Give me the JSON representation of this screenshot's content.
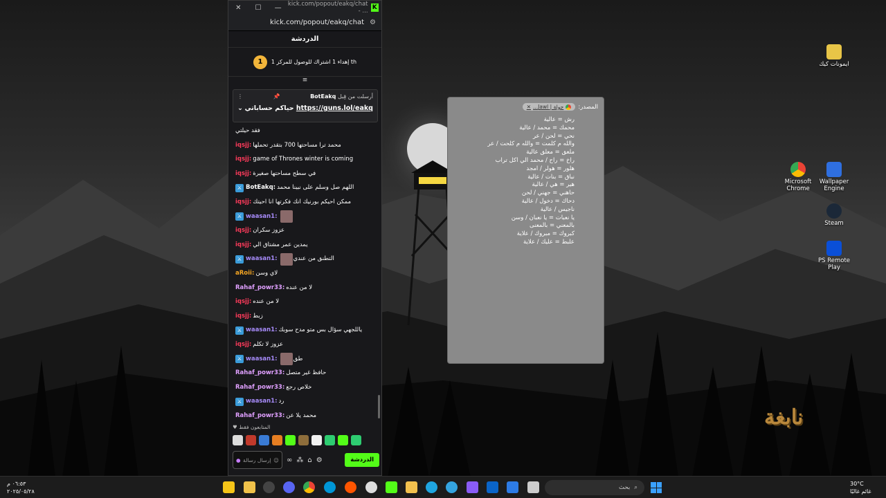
{
  "window": {
    "title": "kick.com/popout/eakq/chat - ...",
    "address": "kick.com/popout/eakq/chat",
    "chat_header": "الدردشة",
    "goal_text": "إهداء 1 اشتراك للوصول للمركز 1 th",
    "goal_badge": "1"
  },
  "pinned": {
    "bot": "BotEakq",
    "sent_label": "أرسلت من قِبل",
    "link": "https://guns.lol/eakq",
    "link_text": "حياكم حساباتي"
  },
  "messages": [
    {
      "user": "",
      "text": "فقد حيلتي",
      "color": "#ffffff",
      "mod": false
    },
    {
      "user": "iqsjj:",
      "text": "محمد ترا مساحتها 700 بتقدر تحملها",
      "color": "#ff3b5b",
      "mod": false
    },
    {
      "user": "iqsjj:",
      "text": "game of Thrones winter is coming",
      "color": "#ff3b5b",
      "mod": false
    },
    {
      "user": "iqsjj:",
      "text": "في سطح مساحتها صغيرة",
      "color": "#ff3b5b",
      "mod": false
    },
    {
      "user": "BotEakq:",
      "text": "اللهم صل وسلم على نبينا محمد",
      "color": "#ffffff",
      "mod": true
    },
    {
      "user": "iqsjj:",
      "text": "ممكن احيكم بورنيك انك فكرتها انا احيتك",
      "color": "#ff3b5b",
      "mod": false
    },
    {
      "user": "waasan1:",
      "text": "",
      "color": "#a78bfa",
      "mod": true,
      "emote": true
    },
    {
      "user": "iqsjj:",
      "text": "عزوز سكران",
      "color": "#ff3b5b",
      "mod": false
    },
    {
      "user": "iqsjj:",
      "text": "يمدين عمر مشتاق الي",
      "color": "#ff3b5b",
      "mod": false
    },
    {
      "user": "waasan1:",
      "text": "التطنق من عندي",
      "color": "#a78bfa",
      "mod": true,
      "emote": true
    },
    {
      "user": "aRoii:",
      "text": "لاي وسن",
      "color": "#f5a623",
      "mod": false
    },
    {
      "user": "Rahaf_powr33:",
      "text": "لا من عنده",
      "color": "#e0a0ff",
      "mod": false
    },
    {
      "user": "iqsjj:",
      "text": "لا من عنده",
      "color": "#ff3b5b",
      "mod": false
    },
    {
      "user": "iqsjj:",
      "text": "زبط",
      "color": "#ff3b5b",
      "mod": false
    },
    {
      "user": "waasan1:",
      "text": "ياللجهي سؤال بس متو مدح سوبك",
      "color": "#a78bfa",
      "mod": true
    },
    {
      "user": "iqsjj:",
      "text": "عزوز لا تكلم",
      "color": "#ff3b5b",
      "mod": false
    },
    {
      "user": "waasan1:",
      "text": "طق",
      "color": "#a78bfa",
      "mod": true,
      "emote": true
    },
    {
      "user": "Rahaf_powr33:",
      "text": "حافظ غير متصل",
      "color": "#e0a0ff",
      "mod": false
    },
    {
      "user": "Rahaf_powr33:",
      "text": "خلاص رجع",
      "color": "#e0a0ff",
      "mod": false
    },
    {
      "user": "waasan1:",
      "text": "رد",
      "color": "#a78bfa",
      "mod": true
    },
    {
      "user": "Rahaf_powr33:",
      "text": "محمد يلا عن",
      "color": "#e0a0ff",
      "mod": false
    }
  ],
  "footer": {
    "subs_label": "المتابعون فقط",
    "input_placeholder": "إرسال رسالة",
    "send_button": "الدردشة"
  },
  "note": {
    "source_label": "المصدر:",
    "source_chip": "جولة | Jawl...",
    "lines": [
      "رش = عالية",
      "محمك = محمد / عالية",
      "نحي = لحن / عر",
      "والله م كلمت = والله م كلحت / عر",
      "ملعق = معلق عالية",
      "راخ = راح / محمد الي اكل تراب",
      "هلور = هولر / امجد",
      "نباق = بنات / عالية",
      "هير = هي / عالية",
      "حاهني = جهني / لحن",
      "دحاك = دخول / عالية",
      "ناجيس / عالية",
      "يا نعبات = يا نعبان / وسن",
      "بالمعني = بالمعنى",
      "كبروك = مبروك / علاية",
      "علبط = عليك / علاية"
    ]
  },
  "desktop_icons": [
    {
      "label": "ايمونات كيك",
      "color": "#e8c547"
    },
    {
      "label": "Microsoft Chrome",
      "color": "#4285f4"
    },
    {
      "label": "Wallpaper Engine",
      "color": "#2f6fe0"
    },
    {
      "label": "Steam",
      "color": "#1b2838"
    },
    {
      "label": "PS Remote Play",
      "color": "#0a4fd8"
    }
  ],
  "logo_text": "نابغة",
  "taskbar": {
    "search_placeholder": "بحث",
    "time": "٠٦:٥٣ م",
    "date": "٢٠٢٥/٠٥/٢٨",
    "temp": "30°C",
    "weather": "غائم غالبًا"
  }
}
